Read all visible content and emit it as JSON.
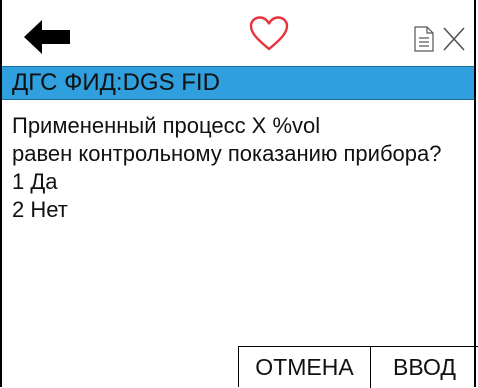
{
  "header": {
    "back_icon": "arrow-left-icon",
    "status_icon": "heart-outline-icon",
    "status_color": "#e8323c",
    "doc_icon": "document-icon",
    "close_icon": "close-icon"
  },
  "titlebar": {
    "title": "ДГС ФИД:DGS FID",
    "background": "#2f9fde"
  },
  "prompt": {
    "lines": [
      "Примененный процесс X %vol",
      "равен контрольному показанию прибора?",
      "1 Да",
      "2 Нет"
    ]
  },
  "softkeys": {
    "cancel_label": "ОТМЕНА",
    "enter_label": "ВВОД"
  }
}
